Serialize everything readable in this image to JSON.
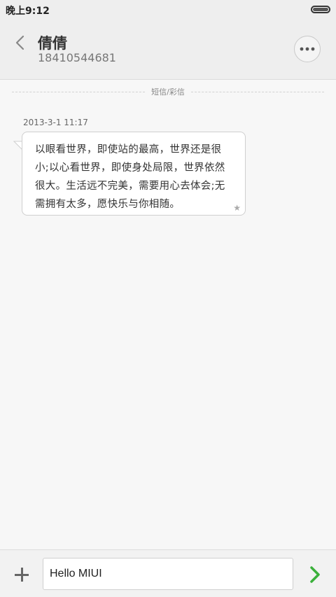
{
  "status_bar": {
    "time": "晚上9:12"
  },
  "header": {
    "contact_name": "倩倩",
    "contact_number": "18410544681"
  },
  "conversation": {
    "channel_label": "短信/彩信",
    "messages": [
      {
        "timestamp": "2013-3-1 11:17",
        "text": "以眼看世界，即使站的最高，世界还是很小;以心看世界，即使身处局限，世界依然很大。生活远不完美，需要用心去体会;无需拥有太多，愿快乐与你相随。",
        "starred": true
      }
    ]
  },
  "composer": {
    "input_value": "Hello MIUI"
  },
  "icons": {
    "back": "chevron-left-icon",
    "more": "more-options-icon",
    "add": "plus-icon",
    "send": "send-arrow-icon",
    "star": "star-icon"
  },
  "colors": {
    "send_accent": "#3bb03b",
    "background": "#f7f7f7",
    "header_bg": "#eeeeee"
  }
}
